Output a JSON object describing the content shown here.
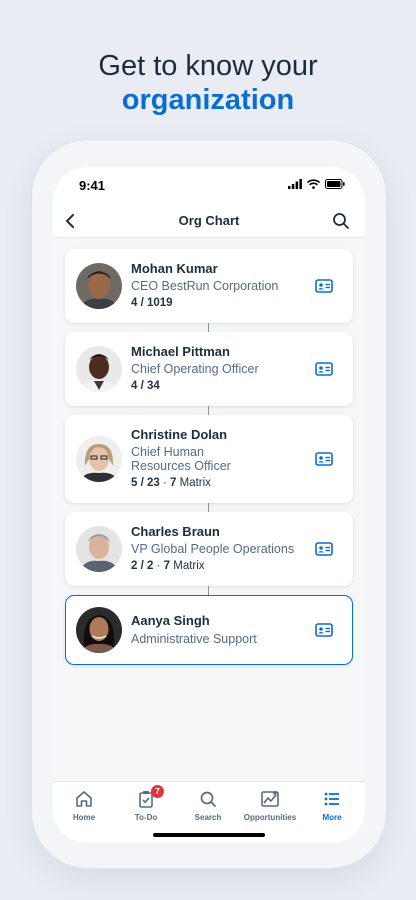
{
  "headline": {
    "line1": "Get to know your",
    "line2": "organization"
  },
  "status_bar": {
    "time": "9:41"
  },
  "nav": {
    "title": "Org Chart"
  },
  "employees": [
    {
      "name": "Mohan Kumar",
      "title": "CEO BestRun Corporation",
      "counts_a": "4 / 1019",
      "counts_b": ""
    },
    {
      "name": "Michael Pittman",
      "title": "Chief Operating Officer",
      "counts_a": "4 / 34",
      "counts_b": ""
    },
    {
      "name": "Christine Dolan",
      "title": "Chief Human Resources Officer",
      "counts_a": "5 / 23",
      "counts_b": "7",
      "matrix_label": "Matrix"
    },
    {
      "name": "Charles Braun",
      "title": "VP Global People Operations",
      "counts_a": "2 / 2",
      "counts_b": "7",
      "matrix_label": "Matrix"
    },
    {
      "name": "Aanya Singh",
      "title": "Administrative Support",
      "counts_a": "",
      "counts_b": ""
    }
  ],
  "tabs": [
    {
      "label": "Home",
      "icon": "home-icon"
    },
    {
      "label": "To-Do",
      "icon": "todo-icon",
      "badge": "7"
    },
    {
      "label": "Search",
      "icon": "search-icon"
    },
    {
      "label": "Opportunities",
      "icon": "opportunities-icon"
    },
    {
      "label": "More",
      "icon": "list-icon",
      "active": true
    }
  ],
  "colors": {
    "accent": "#0a6ed1",
    "badge": "#e2353b",
    "text": "#1d2d3e"
  }
}
